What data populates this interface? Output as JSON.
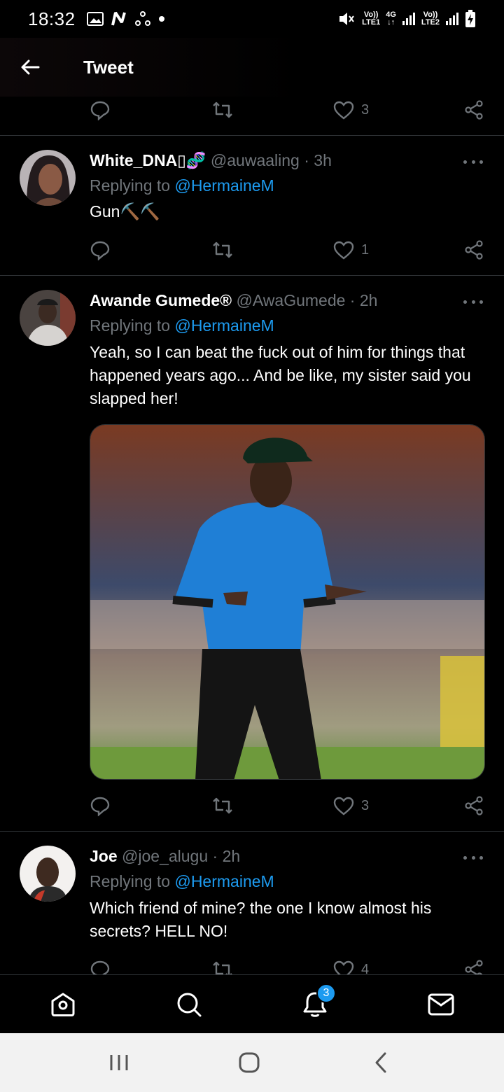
{
  "status_bar": {
    "time": "18:32",
    "net1": {
      "top": "Vo))",
      "bottom": "LTE1"
    },
    "net_type": {
      "top": "4G",
      "bottom": "↓↑"
    },
    "net2": {
      "top": "Vo))",
      "bottom": "LTE2"
    }
  },
  "header": {
    "title": "Tweet"
  },
  "top_actions": {
    "like_count": "3"
  },
  "tweets": [
    {
      "name": "White_DNA▯🧬",
      "handle": "@auwaaling · 3h",
      "replying_prefix": "Replying to ",
      "replying_to": "@HermaineM",
      "text": "Gun⛏️⛏️",
      "like_count": "1"
    },
    {
      "name": "Awande Gumede®",
      "handle": "@AwaGumede · 2h",
      "replying_prefix": "Replying to ",
      "replying_to": "@HermaineM",
      "text": "Yeah, so I can beat the fuck out of him for things that happened years ago... And be like, my sister said you slapped her!",
      "like_count": "3"
    },
    {
      "name": "Joe",
      "handle": "@joe_alugu · 2h",
      "replying_prefix": "Replying to ",
      "replying_to": "@HermaineM",
      "text": "Which friend of mine? the one I know almost his secrets? HELL NO!",
      "like_count": "4"
    }
  ],
  "bottom_nav": {
    "notification_badge": "3"
  },
  "colors": {
    "background": "#000000",
    "accent": "#1d9bf0",
    "muted": "#71767b",
    "divider": "#2f3336"
  }
}
